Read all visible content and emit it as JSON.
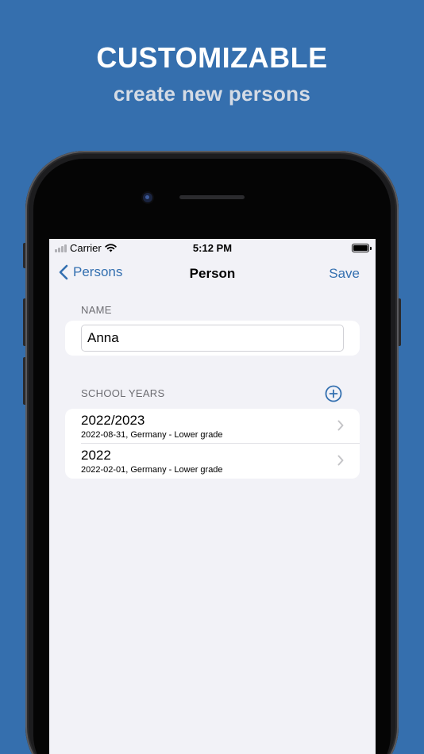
{
  "promo": {
    "headline": "CUSTOMIZABLE",
    "subline": "create new persons"
  },
  "status_bar": {
    "carrier": "Carrier",
    "time": "5:12 PM"
  },
  "nav": {
    "back_label": "Persons",
    "title": "Person",
    "save_label": "Save"
  },
  "name_section": {
    "label": "NAME",
    "value": "Anna"
  },
  "school_years": {
    "label": "SCHOOL YEARS",
    "items": [
      {
        "title": "2022/2023",
        "subtitle": "2022-08-31, Germany - Lower grade"
      },
      {
        "title": "2022",
        "subtitle": "2022-02-01, Germany - Lower grade"
      }
    ]
  },
  "colors": {
    "background": "#356fae",
    "accent": "#3470b0",
    "screen_bg": "#f2f2f7"
  }
}
